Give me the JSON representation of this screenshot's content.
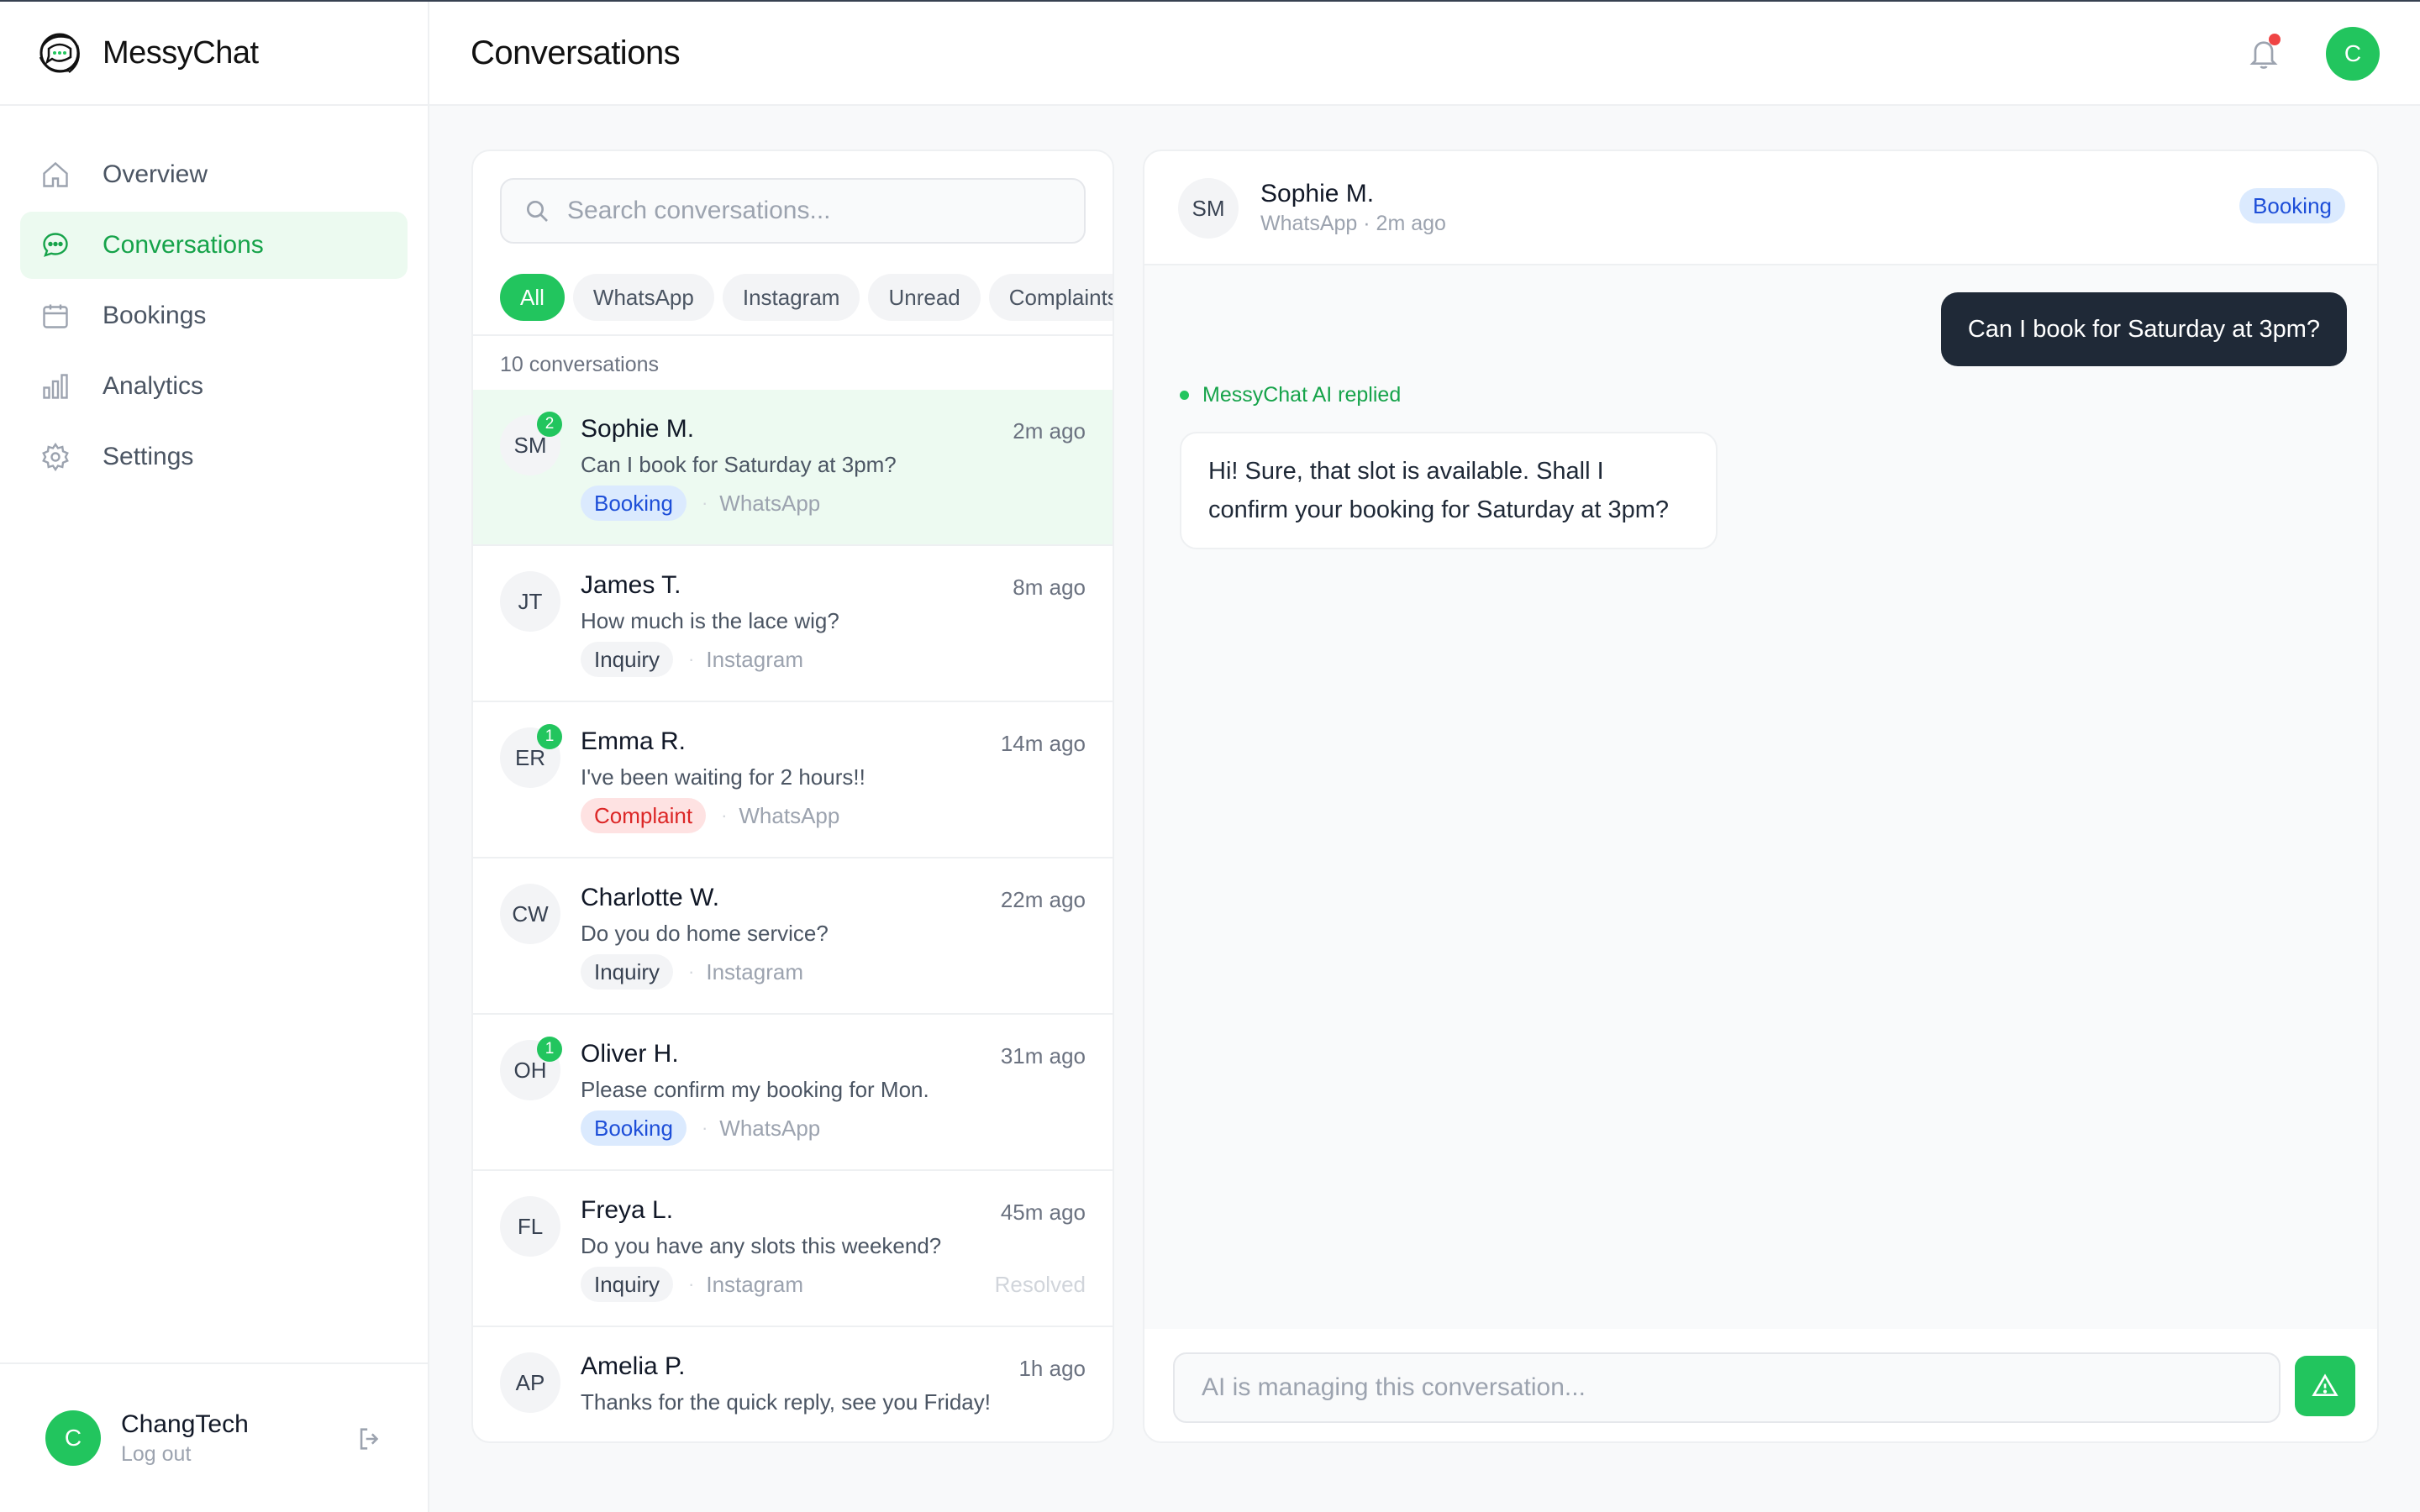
{
  "app": {
    "name": "MessyChat"
  },
  "sidebar": {
    "items": [
      {
        "label": "Overview",
        "icon": "home-icon"
      },
      {
        "label": "Conversations",
        "icon": "chat-icon",
        "active": true
      },
      {
        "label": "Bookings",
        "icon": "calendar-icon"
      },
      {
        "label": "Analytics",
        "icon": "bar-chart-icon"
      },
      {
        "label": "Settings",
        "icon": "gear-icon"
      }
    ],
    "user": {
      "initial": "C",
      "name": "ChangTech",
      "logout": "Log out"
    }
  },
  "header": {
    "title": "Conversations",
    "avatar_initial": "C"
  },
  "list": {
    "search_placeholder": "Search conversations...",
    "filters": [
      "All",
      "WhatsApp",
      "Instagram",
      "Unread",
      "Complaints"
    ],
    "count_label": "10 conversations",
    "conversations": [
      {
        "initials": "SM",
        "unread": "2",
        "name": "Sophie M.",
        "time": "2m ago",
        "message": "Can I book for Saturday at 3pm?",
        "tag": "Booking",
        "channel": "WhatsApp"
      },
      {
        "initials": "JT",
        "name": "James T.",
        "time": "8m ago",
        "message": "How much is the lace wig?",
        "tag": "Inquiry",
        "channel": "Instagram"
      },
      {
        "initials": "ER",
        "unread": "1",
        "name": "Emma R.",
        "time": "14m ago",
        "message": "I've been waiting for 2 hours!!",
        "tag": "Complaint",
        "channel": "WhatsApp"
      },
      {
        "initials": "CW",
        "name": "Charlotte W.",
        "time": "22m ago",
        "message": "Do you do home service?",
        "tag": "Inquiry",
        "channel": "Instagram"
      },
      {
        "initials": "OH",
        "unread": "1",
        "name": "Oliver H.",
        "time": "31m ago",
        "message": "Please confirm my booking for Mon.",
        "tag": "Booking",
        "channel": "WhatsApp"
      },
      {
        "initials": "FL",
        "name": "Freya L.",
        "time": "45m ago",
        "message": "Do you have any slots this weekend?",
        "tag": "Inquiry",
        "channel": "Instagram",
        "status": "Resolved"
      },
      {
        "initials": "AP",
        "name": "Amelia P.",
        "time": "1h ago",
        "message": "Thanks for the quick reply, see you Friday!"
      }
    ]
  },
  "chat": {
    "contact": {
      "initials": "SM",
      "name": "Sophie M.",
      "subtitle": "WhatsApp · 2m ago",
      "tag": "Booking"
    },
    "outgoing": "Can I book for Saturday at 3pm?",
    "ai_label": "MessyChat AI replied",
    "incoming": "Hi! Sure, that slot is available. Shall I confirm your booking for Saturday at 3pm?",
    "input_placeholder": "AI is managing this conversation..."
  },
  "colors": {
    "accent": "#22c55e",
    "accent_text": "#16a34a",
    "dark_bubble": "#1f2937",
    "booking": "#1d4ed8",
    "complaint": "#dc2626"
  }
}
